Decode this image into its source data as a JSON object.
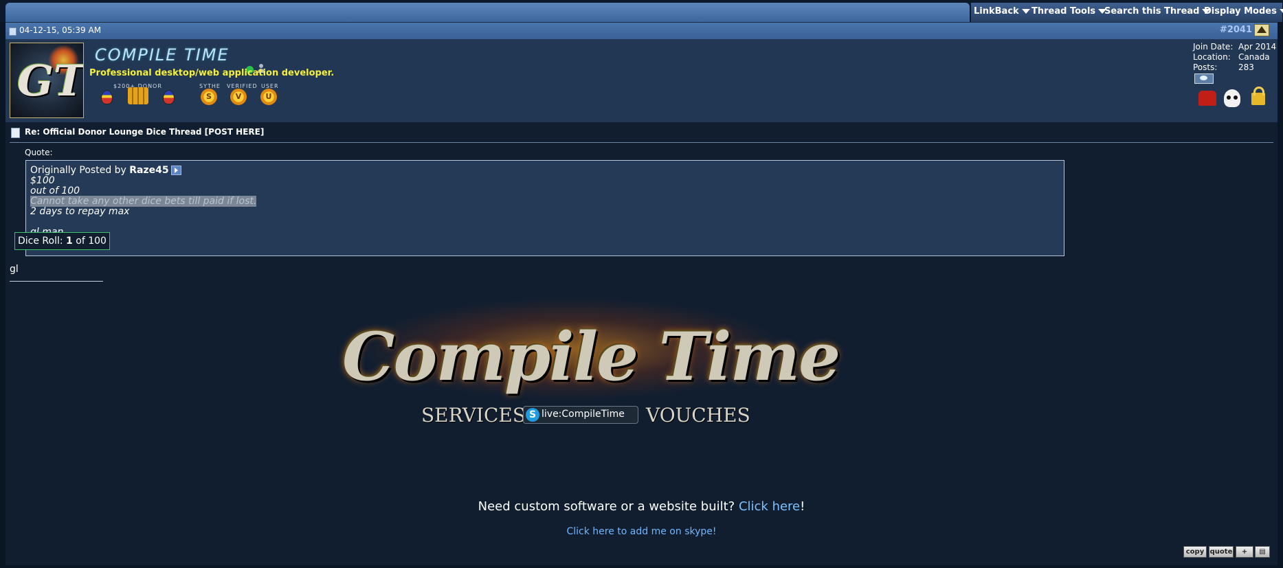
{
  "toolbar": {
    "linkback": "LinkBack",
    "thread_tools": "Thread Tools",
    "search_thread": "Search this Thread",
    "display_modes": "Display Modes"
  },
  "post_header": {
    "date": "04-12-15, 05:39 AM",
    "post_number": "#2041"
  },
  "user": {
    "username": "COMPILE TIME",
    "title": "Professional desktop/web application developer.",
    "badge_labels": {
      "donor": "$200+ DONOR",
      "sythe": "SYTHE",
      "verified": "VERIFIED",
      "user": "USER"
    },
    "medals": [
      "S",
      "V",
      "U"
    ],
    "stats": [
      {
        "key": "Join Date:",
        "value": "Apr 2014"
      },
      {
        "key": "Location:",
        "value": "Canada"
      },
      {
        "key": "Posts:",
        "value": "283"
      }
    ]
  },
  "post": {
    "title": "Re: Official Donor Lounge Dice Thread [POST HERE]",
    "quote_label": "Quote:",
    "quote": {
      "prefix": "Originally Posted by ",
      "author": "Raze45",
      "lines": [
        "$100",
        "out of 100",
        "Cannot take any other dice bets till paid if lost.",
        "2 days to repay max",
        "gl man"
      ]
    },
    "dice": {
      "label": "Dice Roll: ",
      "roll": "1",
      "suffix": " of 100"
    },
    "text": "gl"
  },
  "signature": {
    "logo": "Compile Time",
    "services": "SERVICES",
    "skype_tag": "live:CompileTime",
    "vouches": "VOUCHES",
    "need_text": "Need custom software or a website built? ",
    "click_here": "Click here",
    "exclaim": "!",
    "skype_link": "Click here to add me on skype!"
  },
  "post_buttons": {
    "copy": "copy",
    "quote": "quote"
  }
}
